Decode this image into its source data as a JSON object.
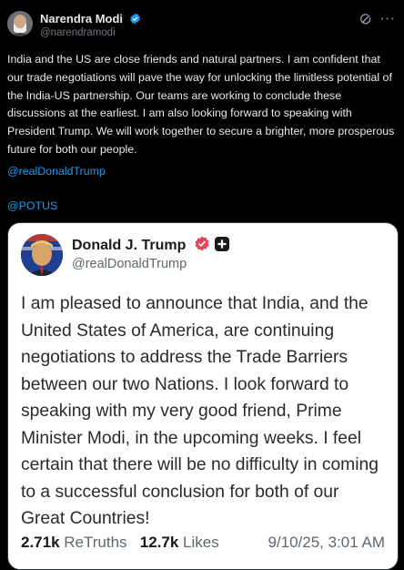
{
  "post": {
    "author_name": "Narendra Modi",
    "author_handle": "@narendramodi",
    "text": "India and the US are close friends and natural partners. I am confident that our trade negotiations will pave the way for unlocking the limitless potential of the India-US partnership. Our teams are working to conclude these discussions at the earliest. I am also looking forward to speaking with President Trump. We will work together to secure a brighter, more prosperous future for both our people.",
    "mentions": [
      "@realDonaldTrump",
      "@POTUS"
    ],
    "more_label": "···"
  },
  "embedded": {
    "author_name": "Donald J. Trump",
    "author_handle": "@realDonaldTrump",
    "text": "I am pleased to announce that India, and the United States of America, are continuing negotiations to address the Trade Barriers between our two Nations. I look forward to speaking with my very good friend, Prime Minister Modi, in the upcoming weeks. I feel certain that there will be no difficulty in coming to a successful conclusion for both of our Great Countries!",
    "retruths_count": "2.71k",
    "retruths_label": "ReTruths",
    "likes_count": "12.7k",
    "likes_label": "Likes",
    "timestamp": "9/10/25, 3:01 AM"
  },
  "icons": {
    "verified": "verified-badge-icon",
    "grok": "grok-icon",
    "more": "more-options-icon",
    "truth_verified": "truth-verified-badge-icon",
    "truth_plus": "truth-plus-badge-icon"
  },
  "colors": {
    "link": "#1d9bf0",
    "background": "#000000",
    "card_background": "#ffffff",
    "verified": "#1d9bf0",
    "truth_badge": "#e8425f"
  }
}
